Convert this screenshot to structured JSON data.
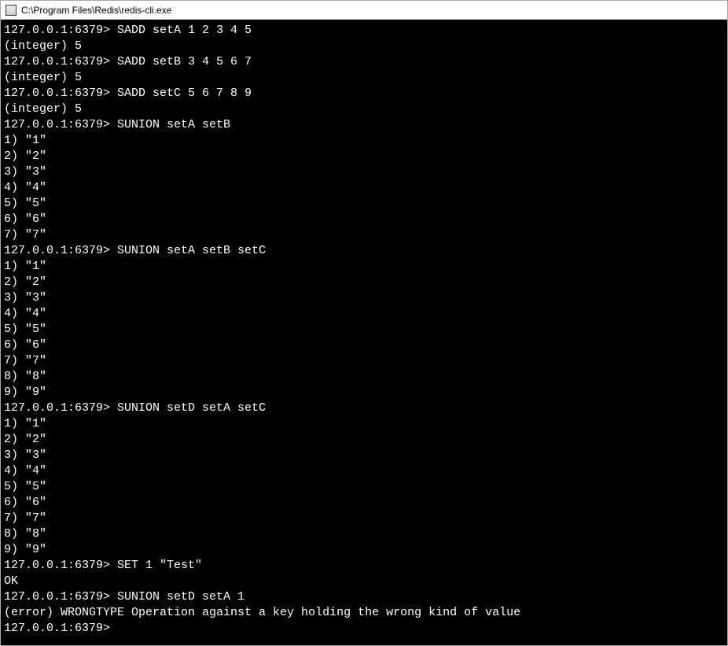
{
  "title": "C:\\Program Files\\Redis\\redis-cli.exe",
  "prompt": "127.0.0.1:6379>",
  "lines": [
    {
      "type": "cmd",
      "text": "SADD setA 1 2 3 4 5"
    },
    {
      "type": "out",
      "text": "(integer) 5"
    },
    {
      "type": "cmd",
      "text": "SADD setB 3 4 5 6 7"
    },
    {
      "type": "out",
      "text": "(integer) 5"
    },
    {
      "type": "cmd",
      "text": "SADD setC 5 6 7 8 9"
    },
    {
      "type": "out",
      "text": "(integer) 5"
    },
    {
      "type": "cmd",
      "text": "SUNION setA setB"
    },
    {
      "type": "out",
      "text": "1) \"1\""
    },
    {
      "type": "out",
      "text": "2) \"2\""
    },
    {
      "type": "out",
      "text": "3) \"3\""
    },
    {
      "type": "out",
      "text": "4) \"4\""
    },
    {
      "type": "out",
      "text": "5) \"5\""
    },
    {
      "type": "out",
      "text": "6) \"6\""
    },
    {
      "type": "out",
      "text": "7) \"7\""
    },
    {
      "type": "cmd",
      "text": "SUNION setA setB setC"
    },
    {
      "type": "out",
      "text": "1) \"1\""
    },
    {
      "type": "out",
      "text": "2) \"2\""
    },
    {
      "type": "out",
      "text": "3) \"3\""
    },
    {
      "type": "out",
      "text": "4) \"4\""
    },
    {
      "type": "out",
      "text": "5) \"5\""
    },
    {
      "type": "out",
      "text": "6) \"6\""
    },
    {
      "type": "out",
      "text": "7) \"7\""
    },
    {
      "type": "out",
      "text": "8) \"8\""
    },
    {
      "type": "out",
      "text": "9) \"9\""
    },
    {
      "type": "cmd",
      "text": "SUNION setD setA setC"
    },
    {
      "type": "out",
      "text": "1) \"1\""
    },
    {
      "type": "out",
      "text": "2) \"2\""
    },
    {
      "type": "out",
      "text": "3) \"3\""
    },
    {
      "type": "out",
      "text": "4) \"4\""
    },
    {
      "type": "out",
      "text": "5) \"5\""
    },
    {
      "type": "out",
      "text": "6) \"6\""
    },
    {
      "type": "out",
      "text": "7) \"7\""
    },
    {
      "type": "out",
      "text": "8) \"8\""
    },
    {
      "type": "out",
      "text": "9) \"9\""
    },
    {
      "type": "cmd",
      "text": "SET 1 \"Test\""
    },
    {
      "type": "out",
      "text": "OK"
    },
    {
      "type": "cmd",
      "text": "SUNION setD setA 1"
    },
    {
      "type": "out",
      "text": "(error) WRONGTYPE Operation against a key holding the wrong kind of value"
    },
    {
      "type": "prompt-only",
      "text": ""
    }
  ]
}
